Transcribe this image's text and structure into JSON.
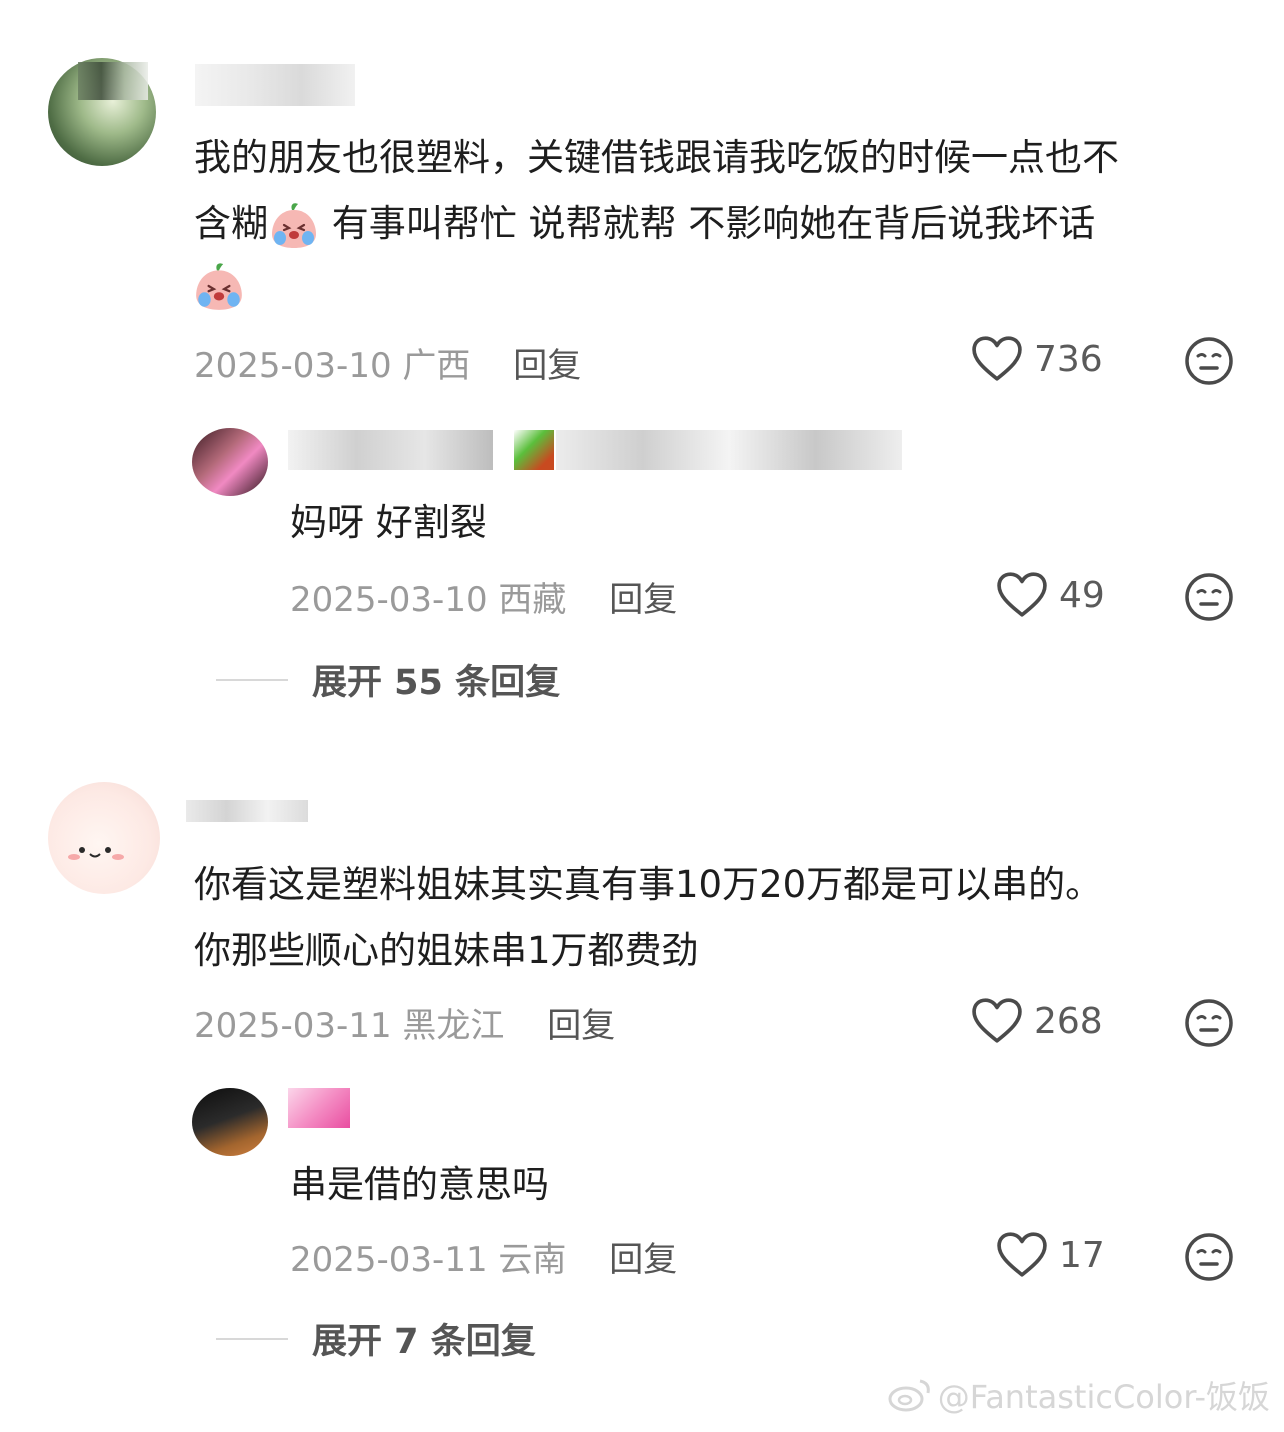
{
  "comments": [
    {
      "text_line1": "我的朋友也很塑料，关键借钱跟请我吃饭的时候一点也不",
      "text_line2a": "含糊",
      "text_line2b": " 有事叫帮忙 说帮就帮 不影响她在背后说我坏话",
      "date": "2025-03-10",
      "location": "广西",
      "reply_label": "回复",
      "likes": "736",
      "reply": {
        "text": "妈呀 好割裂",
        "date": "2025-03-10",
        "location": "西藏",
        "reply_label": "回复",
        "likes": "49"
      },
      "expand_label": "展开 55 条回复"
    },
    {
      "text_line1": "你看这是塑料姐妹其实真有事10万20万都是可以串的。",
      "text_line2": "你那些顺心的姐妹串1万都费劲",
      "date": "2025-03-11",
      "location": "黑龙江",
      "reply_label": "回复",
      "likes": "268",
      "reply": {
        "text": "串是借的意思吗",
        "date": "2025-03-11",
        "location": "云南",
        "reply_label": "回复",
        "likes": "17"
      },
      "expand_label": "展开 7 条回复"
    }
  ],
  "watermark": "@FantasticColor-饭饭",
  "icons": {
    "like": "heart-outline-icon",
    "react": "neutral-face-icon",
    "emoji": "crying-peach-emoji"
  }
}
